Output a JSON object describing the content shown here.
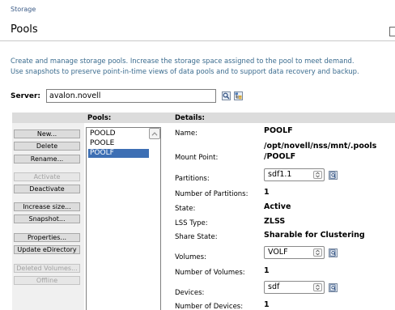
{
  "breadcrumb": "Storage",
  "page": {
    "title": "Pools",
    "description_line1": "Create and manage storage pools. Increase the storage space assigned to the pool to meet demand.",
    "description_line2": "Use snapshots to preserve point-in-time views of data pools and to support data recovery and backup."
  },
  "server": {
    "label": "Server:",
    "value": "avalon.novell",
    "search_icon": "search-icon",
    "browse_icon": "tree-browse-icon"
  },
  "headers": {
    "pools": "Pools:",
    "details": "Details:"
  },
  "actions": {
    "new": "New...",
    "delete": "Delete",
    "rename": "Rename...",
    "activate": "Activate",
    "deactivate": "Deactivate",
    "increase_size": "Increase size...",
    "snapshot": "Snapshot...",
    "properties": "Properties...",
    "update_edirectory": "Update eDirectory",
    "deleted_volumes": "Deleted Volumes...",
    "offline": "Offline"
  },
  "pools": {
    "items": [
      "POOLD",
      "POOLE",
      "POOLF"
    ],
    "selected": "POOLF"
  },
  "details": {
    "name_label": "Name:",
    "name_value": "POOLF",
    "mount_label": "Mount Point:",
    "mount_value_line1": "/opt/novell/nss/mnt/.pools",
    "mount_value_line2": "/POOLF",
    "partitions_label": "Partitions:",
    "partitions_value": "sdf1.1",
    "num_partitions_label": "Number of Partitions:",
    "num_partitions_value": "1",
    "state_label": "State:",
    "state_value": "Active",
    "lss_label": "LSS Type:",
    "lss_value": "ZLSS",
    "share_label": "Share State:",
    "share_value": "Sharable for Clustering",
    "volumes_label": "Volumes:",
    "volumes_value": "VOLF",
    "num_volumes_label": "Number of Volumes:",
    "num_volumes_value": "1",
    "devices_label": "Devices:",
    "devices_value": "sdf",
    "num_devices_label": "Number of Devices:",
    "num_devices_value": "1"
  },
  "colors": {
    "breadcrumb": "#3a5a86",
    "description": "#3a6b8e",
    "selection": "#3d6fb4",
    "header_band": "#dcdcdc",
    "disabled_text": "#a3a3a3"
  }
}
